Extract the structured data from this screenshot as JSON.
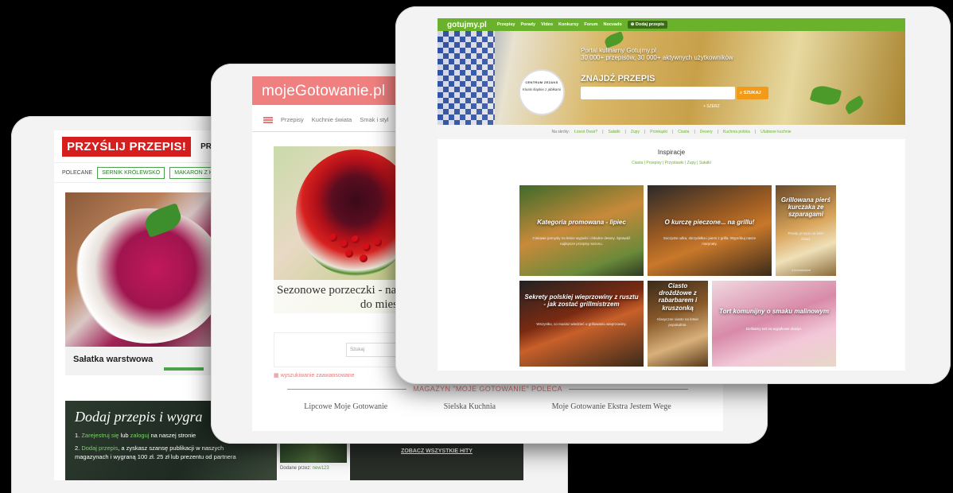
{
  "t1": {
    "logo": "PRZYŚLIJ PRZEPIS!",
    "nav": [
      "PRZEPISY",
      "AR"
    ],
    "tags_label": "POLECANE",
    "tags": [
      "SERNIK KRÓLEWSKO",
      "MAKARON Z KURCZ"
    ],
    "hero_caption": "Sałatka warstwowa",
    "promo_title": "Dodaj przepis i wygra",
    "promo_line1_a": "1. ",
    "promo_line1_hl1": "Zarejestruj się",
    "promo_line1_b": " lub ",
    "promo_line1_hl2": "zaloguj",
    "promo_line1_c": " na naszej stronie",
    "promo_line2_a": "2. ",
    "promo_line2_hl": "Dodaj przepis",
    "promo_line2_b": ", a zyskasz szansę publikacji w naszych",
    "promo_line3": "magazynach i wygraną 100 zł. 25 zł lub prezentu od partnera",
    "side_caption_a": "Dodane przez: ",
    "side_caption_user": "new123",
    "dark_cta": "ZOBACZ WSZYSTKIE HITY"
  },
  "t2": {
    "logo": "mojeGotowanie.pl",
    "nav": [
      "Przepisy",
      "Kuchnie świata",
      "Smak i styl"
    ],
    "hero_title_1": "Sezonowe porzeczki - na",
    "hero_title_2": "do mies",
    "search_placeholder": "Szukaj",
    "advanced_search": "wyszukiwanie zaawansowane",
    "magazine_heading": "MAGAZYN \"MOJE GOTOWANIE\" POLECA",
    "magazine_links": [
      "Lipcowe Moje Gotowanie",
      "Sielska Kuchnia",
      "Moje Gotowanie Ekstra Jestem Wege"
    ]
  },
  "t3": {
    "logo": "gotujmy.pl",
    "nav": [
      "Przepisy",
      "Porady",
      "Video",
      "Konkursy",
      "Forum",
      "Nocvado"
    ],
    "add_recipe": "Dodaj przepis",
    "hero_line1": "Portal kulinarny Gotujmy.pl",
    "hero_line2": "30 000+ przepisów, 30 000+ aktywnych użytkowników",
    "find_recipe": "ZNAJDŹ PRZEPIS",
    "search_button": "SZUKAJ",
    "more": "+ SZERZ",
    "badge_brand": "CENTRUM ZEZAKS",
    "badge_text": "Kluski śląskie z jabłkami",
    "popular_label": "Na skróty:",
    "popular": [
      "Łosoś Dwar?",
      "Sałatki",
      "Zupy",
      "Przekąski",
      "Ciasta",
      "Desery",
      "Kuchnia polska",
      "Ulubione kuchnie"
    ],
    "inspiracje": "Inspiracje",
    "inspiracje_sub": [
      "Ciasta",
      "Przepisy",
      "Przystawki",
      "Zupy",
      "Sałatki"
    ],
    "tiles": [
      {
        "title": "Kategoria promowana - lipiec",
        "desc": "Ciekawe pomysły na letnie wypieki i chłodne desery. Sprawdź najlepsze przepisy sezonu."
      },
      {
        "title": "O kurczę pieczone... na grillu!",
        "desc": "Soczyste udka, skrzydełka i piersi z grilla. Wypróbuj nasze marynaty."
      },
      {
        "title": "Grillowana pierś kurczaka ze szparagami",
        "desc": "Prosty przepis na lekki obiad.",
        "count": "4 komentarze"
      },
      {
        "title": "Sekrety polskiej wieprzowiny z rusztu - jak zostać grillmistrzem",
        "desc": "Wszystko, co musisz wiedzieć o grillowaniu wieprzowiny."
      },
      {
        "title": "Ciasto drożdżowe z rabarbarem i kruszonką",
        "desc": "Klasyczne ciasto na letnie popołudnie."
      },
      {
        "title": "Tort komunijny o smaku malinowym",
        "desc": "Delikatny tort na wyjątkowe okazje."
      }
    ]
  },
  "colors": {
    "przyslij_red": "#d51f1f",
    "moje_pink": "#f08080",
    "gotujmy_green": "#6ab22c",
    "gotujmy_orange": "#f39b18"
  }
}
